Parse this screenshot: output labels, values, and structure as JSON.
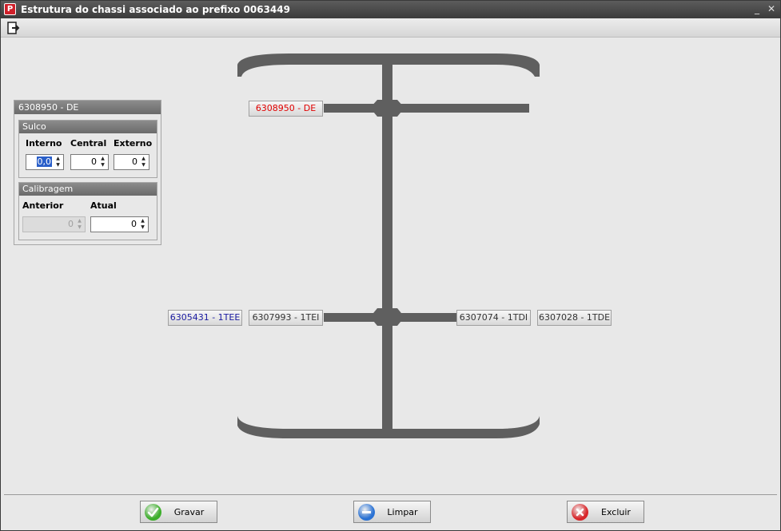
{
  "window": {
    "title": "Estrutura do chassi associado ao prefixo 0063449",
    "app_icon_glyph": "P",
    "minimize_glyph": "_",
    "close_glyph": "✕"
  },
  "toolbar": {
    "exit_icon": "exit-icon"
  },
  "details_panel": {
    "title": "6308950 - DE",
    "sulco": {
      "title": "Sulco",
      "interno_label": "Interno",
      "central_label": "Central",
      "externo_label": "Externo",
      "interno_value": "0,0",
      "central_value": "0",
      "externo_value": "0"
    },
    "calibragem": {
      "title": "Calibragem",
      "anterior_label": "Anterior",
      "atual_label": "Atual",
      "anterior_value": "0",
      "atual_value": "0"
    }
  },
  "chassis": {
    "color": "#5f5f5f",
    "tires": {
      "front_de": {
        "label": "6308950 - DE",
        "color": "#e00000"
      },
      "rear_1tee": {
        "label": "6305431 - 1TEE",
        "color": "#1a1aa0"
      },
      "rear_1tei": {
        "label": "6307993 - 1TEI",
        "color": "#333333"
      },
      "rear_1tdi": {
        "label": "6307074 - 1TDI",
        "color": "#333333"
      },
      "rear_1tde": {
        "label": "6307028 - 1TDE",
        "color": "#333333"
      }
    }
  },
  "footer": {
    "save_label": "Gravar",
    "clear_label": "Limpar",
    "delete_label": "Excluir",
    "save_color": "#3cae2a",
    "clear_color": "#2a72d4",
    "delete_color": "#d8262a"
  }
}
